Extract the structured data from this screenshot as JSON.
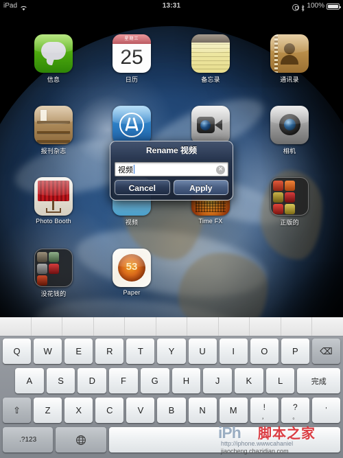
{
  "statusbar": {
    "device": "iPad",
    "wifi_icon": "wifi-icon",
    "time": "13:31",
    "rotation_lock_icon": "rotation-lock-icon",
    "bluetooth_icon": "bluetooth-icon",
    "battery_percent": "100%",
    "battery_icon": "battery-icon"
  },
  "homescreen": {
    "wallpaper": "earth-from-space",
    "apps": [
      {
        "label": "信息",
        "icon": "messages-icon",
        "name": "app-messages"
      },
      {
        "label": "日历",
        "icon": "calendar-icon",
        "name": "app-calendar",
        "day": "25",
        "month": "星期三"
      },
      {
        "label": "备忘录",
        "icon": "notes-icon",
        "name": "app-notes"
      },
      {
        "label": "通讯录",
        "icon": "contacts-icon",
        "name": "app-contacts"
      },
      {
        "label": "报刊杂志",
        "icon": "newsstand-icon",
        "name": "app-newsstand"
      },
      {
        "label": "",
        "icon": "appstore-icon",
        "name": "app-appstore"
      },
      {
        "label": "",
        "icon": "facetime-icon",
        "name": "app-facetime"
      },
      {
        "label": "相机",
        "icon": "camera-icon",
        "name": "app-camera"
      },
      {
        "label": "Photo Booth",
        "icon": "photobooth-icon",
        "name": "app-photobooth"
      },
      {
        "label": "视频",
        "icon": "video-icon",
        "name": "app-video"
      },
      {
        "label": "Time FX",
        "icon": "timefx-icon",
        "name": "app-timefx"
      },
      {
        "label": "正版的",
        "icon": "folder-icon",
        "name": "folder-zhengbande"
      },
      {
        "label": "没花钱的",
        "icon": "folder-icon",
        "name": "folder-meihuaqiande"
      },
      {
        "label": "Paper",
        "icon": "paper-icon",
        "name": "app-paper",
        "badge_number": "53"
      }
    ]
  },
  "dialog": {
    "title": "Rename 视频",
    "field_value": "视频",
    "field_placeholder": "",
    "clear_icon": "✕",
    "cancel_label": "Cancel",
    "apply_label": "Apply"
  },
  "keyboard": {
    "candidate_bar_cells": 11,
    "row1": [
      {
        "label": "Q"
      },
      {
        "label": "W"
      },
      {
        "label": "E"
      },
      {
        "label": "R"
      },
      {
        "label": "T"
      },
      {
        "label": "Y"
      },
      {
        "label": "U"
      },
      {
        "label": "I"
      },
      {
        "label": "O"
      },
      {
        "label": "P"
      },
      {
        "label": "⌫",
        "name": "backspace-key",
        "style": "dark"
      }
    ],
    "row2": [
      {
        "label": "A"
      },
      {
        "label": "S"
      },
      {
        "label": "D"
      },
      {
        "label": "F"
      },
      {
        "label": "G"
      },
      {
        "label": "H"
      },
      {
        "label": "J"
      },
      {
        "label": "K"
      },
      {
        "label": "L"
      },
      {
        "label": "完成",
        "name": "done-key",
        "style": "cjk"
      }
    ],
    "row3": [
      {
        "label": "⇧",
        "name": "shift-key",
        "style": "dark"
      },
      {
        "label": "Z"
      },
      {
        "label": "X"
      },
      {
        "label": "C"
      },
      {
        "label": "V"
      },
      {
        "label": "B"
      },
      {
        "label": "N"
      },
      {
        "label": "M"
      },
      {
        "label": "!",
        "sub": "，",
        "name": "exclamation-comma-key"
      },
      {
        "label": "?",
        "sub": "。",
        "name": "question-period-key"
      },
      {
        "label": "'",
        "name": "apostrophe-key"
      }
    ],
    "row4": [
      {
        "label": ".?123",
        "name": "numeric-key",
        "style": "dark"
      },
      {
        "label": "🌐",
        "name": "globe-key",
        "style": "dark"
      },
      {
        "label": "",
        "name": "space-key"
      }
    ]
  },
  "watermark": {
    "logo": "iPh",
    "brand": "脚本之家",
    "url1": "http://iphone.wwwcahaniel",
    "url2": "jiaocheng.chazidian.com"
  }
}
